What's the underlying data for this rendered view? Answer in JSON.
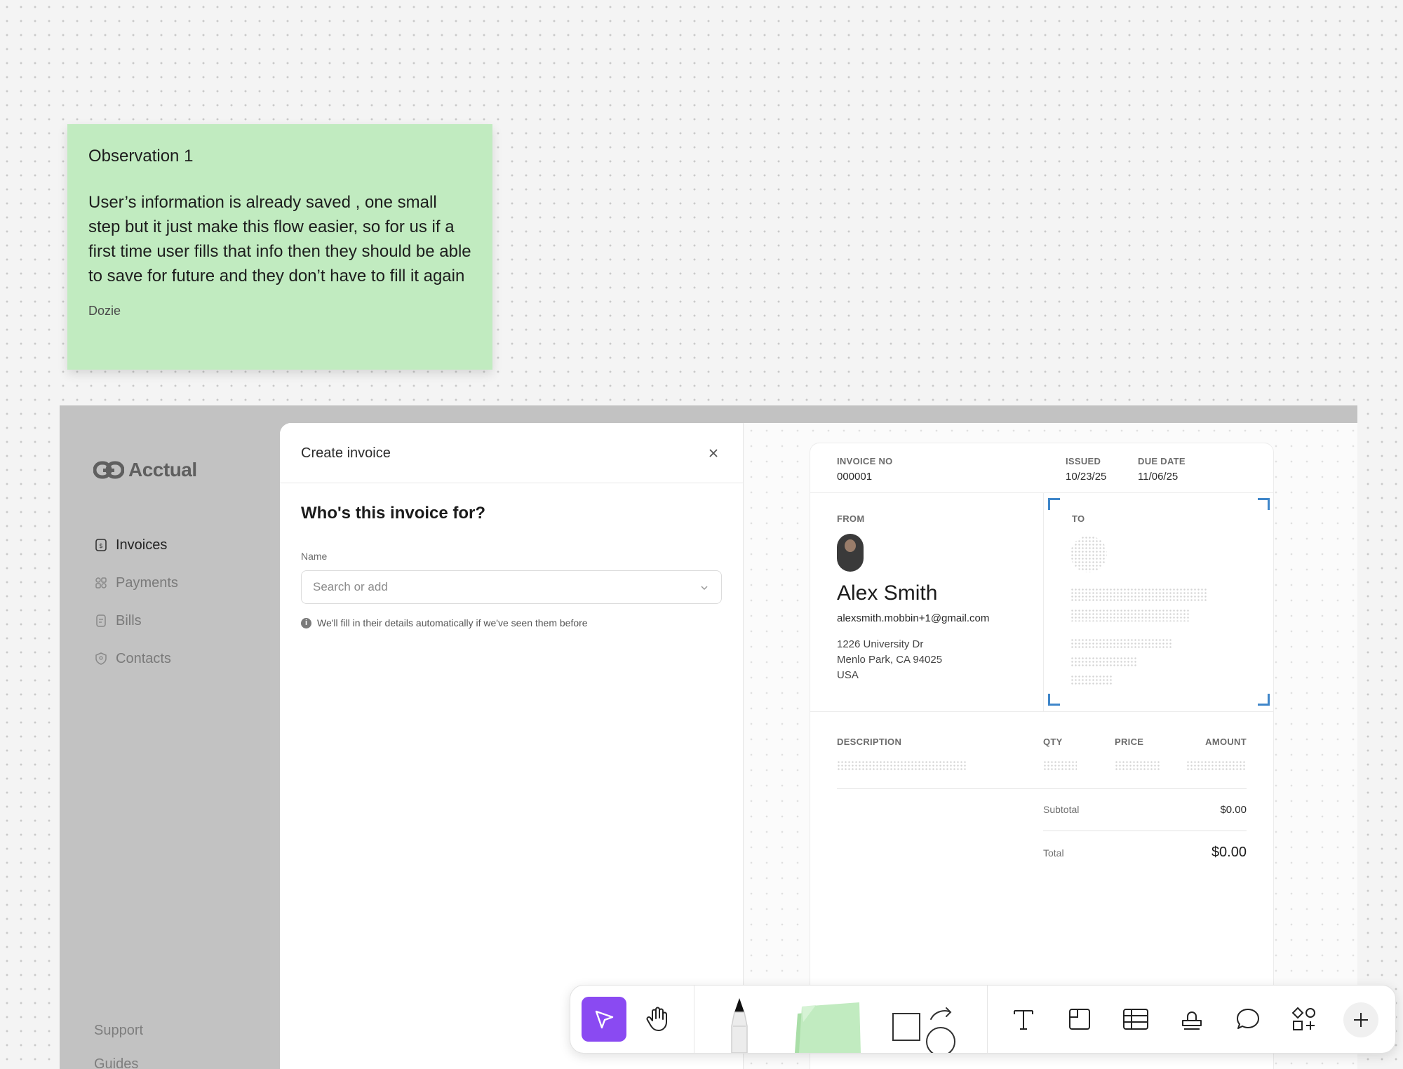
{
  "sticky": {
    "title": "Observation 1",
    "body": "User’s information is already saved , one small step but it just make this flow easier, so for us if a first time user fills that info then they should be able to save for future and they don’t have to fill it again",
    "author": "Dozie",
    "color": "#c1ebc0"
  },
  "app": {
    "logo": "Acctual",
    "nav": [
      {
        "label": "Invoices",
        "icon": "invoice-icon",
        "active": true
      },
      {
        "label": "Payments",
        "icon": "payments-icon"
      },
      {
        "label": "Bills",
        "icon": "bills-icon"
      },
      {
        "label": "Contacts",
        "icon": "contacts-icon"
      }
    ],
    "footer": [
      "Support",
      "Guides"
    ]
  },
  "modal": {
    "title": "Create invoice",
    "question": "Who's this invoice for?",
    "name_label": "Name",
    "name_placeholder": "Search or add",
    "hint": "We'll fill in their details automatically if we've seen them before"
  },
  "invoice": {
    "invoice_no_label": "INVOICE NO",
    "invoice_no": "000001",
    "issued_label": "ISSUED",
    "issued": "10/23/25",
    "due_label": "DUE DATE",
    "due": "11/06/25",
    "from_label": "FROM",
    "from_name": "Alex Smith",
    "from_email": "alexsmith.mobbin+1@gmail.com",
    "from_address": [
      "1226 University Dr",
      "Menlo Park, CA 94025",
      "USA"
    ],
    "to_label": "TO",
    "columns": [
      "DESCRIPTION",
      "QTY",
      "PRICE",
      "AMOUNT"
    ],
    "subtotal_label": "Subtotal",
    "subtotal": "$0.00",
    "total_label": "Total",
    "total": "$0.00",
    "accent": "#3f86c9"
  },
  "toolbar": {
    "accent": "#8a4af2",
    "tools": [
      "select-tool",
      "hand-tool",
      "pen-tool",
      "sticky-note-tool",
      "shape-tool",
      "text-tool",
      "section-tool",
      "table-tool",
      "stamp-tool",
      "comment-tool",
      "widgets-tool",
      "add-tool"
    ]
  }
}
